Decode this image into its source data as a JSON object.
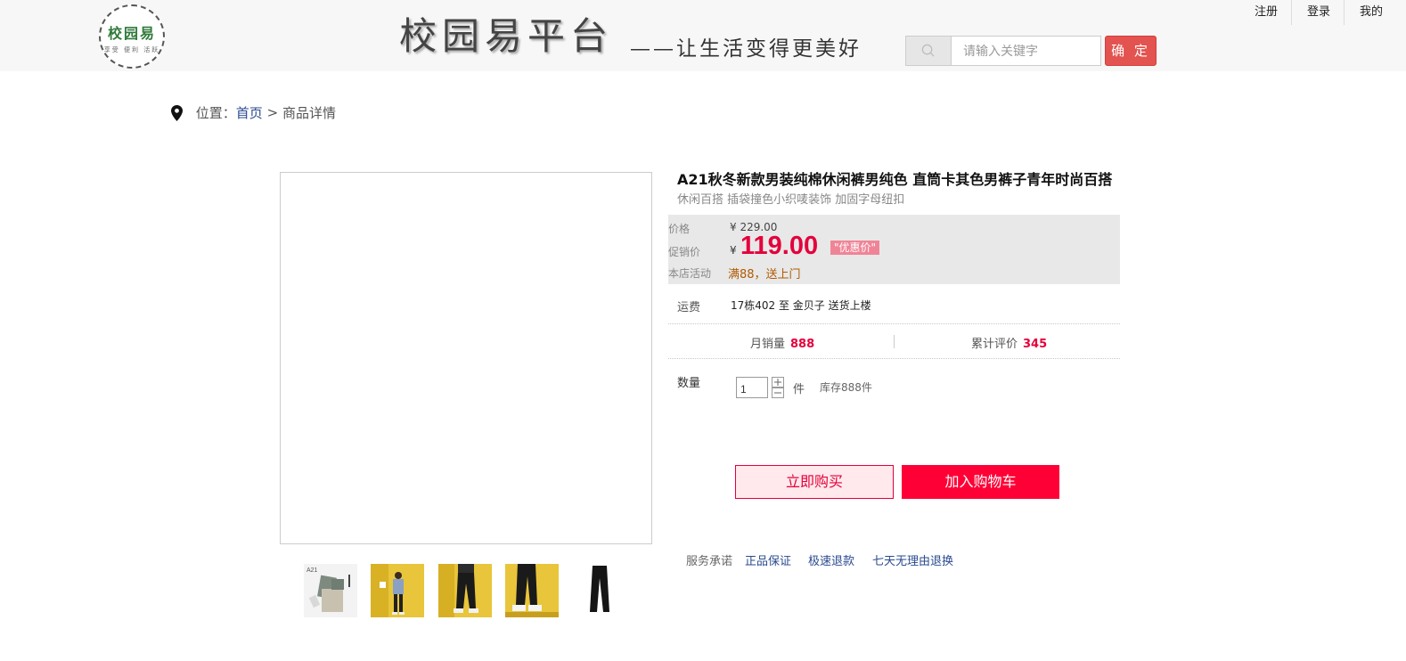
{
  "header": {
    "logo_text": "校园易",
    "logo_subtext": "享受 便利 活跃",
    "site_title": "校园易平台",
    "slogan": "——让生活变得更美好",
    "search_placeholder": "请输入关键字",
    "search_button": "确 定",
    "links": [
      "注册",
      "登录",
      "我的"
    ]
  },
  "breadcrumb": {
    "prefix": "位置：",
    "home": "首页",
    "separator": ">",
    "current": "商品详情"
  },
  "gallery": {
    "thumbnail_count": 5,
    "first_thumb_label": "A21"
  },
  "product": {
    "title": "A21秋冬新款男装纯棉休闲裤男纯色 直筒卡其色男裤子青年时尚百搭",
    "subtitle": "休闲百搭 插袋撞色小织唛装饰 加固字母纽扣",
    "price_label": "价格",
    "original_price": "¥ 229.00",
    "promo_label": "促销价",
    "currency": "¥",
    "promo_price": "119.00",
    "promo_badge": "\"优惠价\"",
    "activity_label": "本店活动",
    "activity": "满88，送上门",
    "shipping_label": "运费",
    "shipping": "17栋402 至 金贝子 送货上楼",
    "monthly_sales_label": "月销量",
    "monthly_sales": "888",
    "reviews_label": "累计评价",
    "reviews": "345",
    "quantity_label": "数量",
    "quantity": "1",
    "unit": "件",
    "stock": "库存888件",
    "buy_now": "立即购买",
    "add_to_cart": "加入购物车",
    "service_label": "服务承诺",
    "services": [
      "正品保证",
      "极速退款",
      "七天无理由退换"
    ]
  },
  "colors": {
    "accent_red": "#e4003b",
    "search_button": "#e3534f",
    "link_blue": "#2a4a8f",
    "price_panel": "#e8e8e8"
  }
}
